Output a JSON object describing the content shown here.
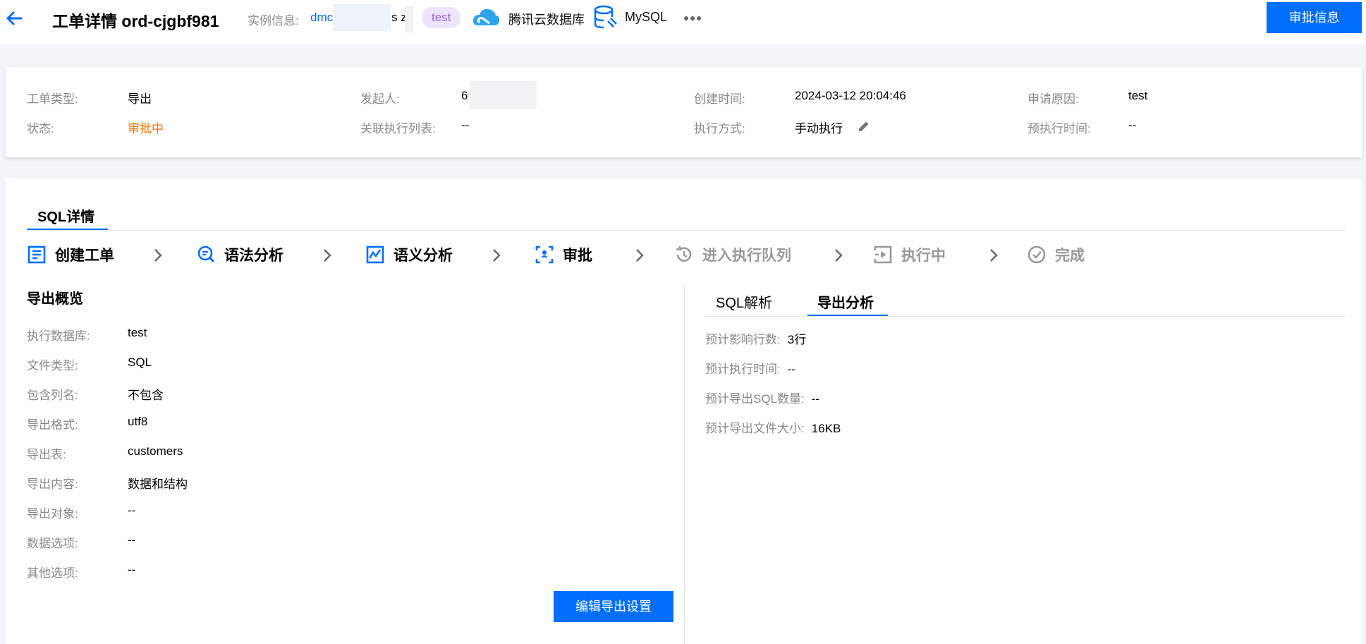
{
  "header": {
    "title": "工单详情 ord-cjgbf981",
    "instance_label": "实例信息:",
    "instance_link": "dmc",
    "instance_suffix": "s zi",
    "tag": "test",
    "cloud_name": "腾讯云数据库",
    "db_type": "MySQL",
    "approve_button": "审批信息"
  },
  "info": {
    "type_label": "工单类型:",
    "type_value": "导出",
    "initiator_label": "发起人:",
    "initiator_value": "6",
    "created_label": "创建时间:",
    "created_value": "2024-03-12 20:04:46",
    "reason_label": "申请原因:",
    "reason_value": "test",
    "status_label": "状态:",
    "status_value": "审批中",
    "exec_list_label": "关联执行列表:",
    "exec_list_value": "--",
    "exec_mode_label": "执行方式:",
    "exec_mode_value": "手动执行",
    "pre_exec_label": "预执行时间:",
    "pre_exec_value": "--"
  },
  "main": {
    "tab": "SQL详情",
    "steps": [
      {
        "label": "创建工单",
        "icon": "list-icon",
        "state": "done"
      },
      {
        "label": "语法分析",
        "icon": "search-icon",
        "state": "done"
      },
      {
        "label": "语义分析",
        "icon": "chart-icon",
        "state": "done"
      },
      {
        "label": "审批",
        "icon": "approve-icon",
        "state": "current"
      },
      {
        "label": "进入执行队列",
        "icon": "history-icon",
        "state": "pending"
      },
      {
        "label": "执行中",
        "icon": "play-icon",
        "state": "pending"
      },
      {
        "label": "完成",
        "icon": "check-circle-icon",
        "state": "pending"
      }
    ],
    "overview": {
      "title": "导出概览",
      "rows": [
        {
          "label": "执行数据库:",
          "value": "test"
        },
        {
          "label": "文件类型:",
          "value": "SQL"
        },
        {
          "label": "包含列名:",
          "value": "不包含"
        },
        {
          "label": "导出格式:",
          "value": "utf8"
        },
        {
          "label": "导出表:",
          "value": "customers"
        },
        {
          "label": "导出内容:",
          "value": "数据和结构"
        },
        {
          "label": "导出对象:",
          "value": "--"
        },
        {
          "label": "数据选项:",
          "value": "--"
        },
        {
          "label": "其他选项:",
          "value": "--"
        }
      ],
      "edit_button": "编辑导出设置"
    },
    "analysis": {
      "tabs": [
        "SQL解析",
        "导出分析"
      ],
      "active_tab": "导出分析",
      "rows": [
        {
          "label": "预计影响行数:",
          "value": "3行"
        },
        {
          "label": "预计执行时间:",
          "value": "--"
        },
        {
          "label": "预计导出SQL数量:",
          "value": "--"
        },
        {
          "label": "预计导出文件大小:",
          "value": "16KB"
        }
      ]
    }
  },
  "colors": {
    "primary": "#006eff",
    "status_orange": "#ff7200",
    "tag_bg": "#ece4fb",
    "tag_text": "#9765d8"
  }
}
